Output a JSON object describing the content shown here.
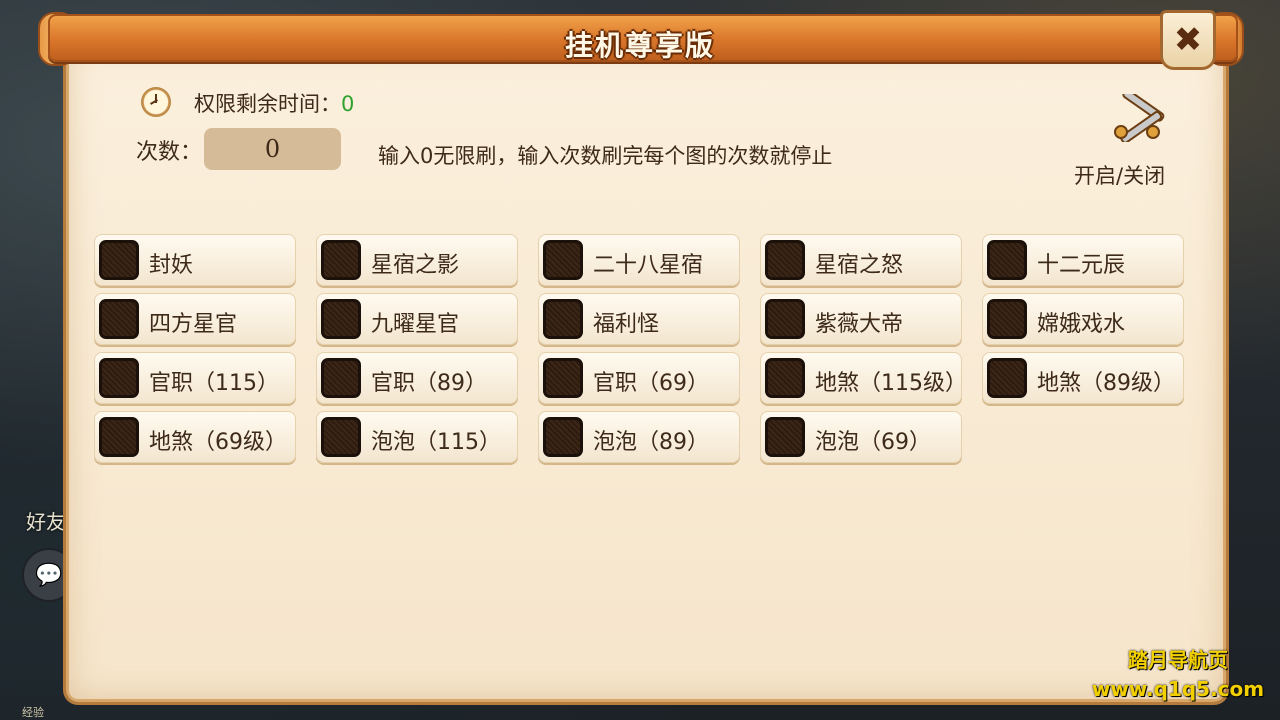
{
  "title": "挂机尊享版",
  "close_symbol": "✖",
  "time": {
    "label": "权限剩余时间：",
    "value": "0"
  },
  "count": {
    "label": "次数：",
    "value": "0"
  },
  "hint": "输入0无限刷，输入次数刷完每个图的次数就停止",
  "toggle": {
    "label": "开启/关闭",
    "icon": "crossed-swords-icon"
  },
  "options": [
    "封妖",
    "星宿之影",
    "二十八星宿",
    "星宿之怒",
    "十二元辰",
    "四方星官",
    "九曜星官",
    "福利怪",
    "紫薇大帝",
    "嫦娥戏水",
    "官职（115）",
    "官职（89）",
    "官职（69）",
    "地煞（115级）",
    "地煞（89级）",
    "地煞（69级）",
    "泡泡（115）",
    "泡泡（89）",
    "泡泡（69）"
  ],
  "side": {
    "friend": "好友",
    "chat_icon": "speech-bubble-icon",
    "exp": "经验"
  },
  "watermark": {
    "line1": "踏月导航页",
    "line2": "www.q1q5.com"
  },
  "colors": {
    "title_bar": "#d9762a",
    "panel": "#f8ead3",
    "time_value": "#2fa12f",
    "watermark": "#f2d000"
  }
}
